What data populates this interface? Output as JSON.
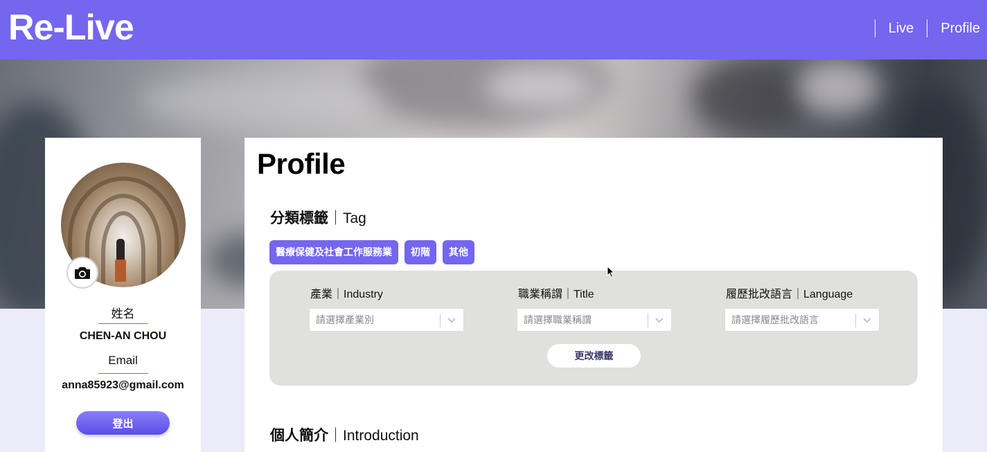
{
  "app": {
    "logo": "Re-Live"
  },
  "nav": {
    "items": [
      "Live",
      "Profile"
    ]
  },
  "sidebar": {
    "name_label": "姓名",
    "name_value": "CHEN-AN CHOU",
    "email_label": "Email",
    "email_value": "anna85923@gmail.com",
    "logout_label": "登出",
    "camera_icon": "camera-icon"
  },
  "main": {
    "title": "Profile",
    "tag_section": {
      "title_zh": "分類標籤",
      "title_sep": "｜",
      "title_en": "Tag"
    },
    "tags": [
      "醫療保健及社會工作服務業",
      "初階",
      "其他"
    ],
    "filters": [
      {
        "label": "產業｜Industry",
        "placeholder": "請選擇產業別"
      },
      {
        "label": "職業稱謂｜Title",
        "placeholder": "請選擇職業稱謂"
      },
      {
        "label": "履歷批改語言｜Language",
        "placeholder": "請選擇履歷批改語言"
      }
    ],
    "change_button": "更改標籤",
    "intro_section": {
      "title_zh": "個人簡介",
      "title_sep": "｜",
      "title_en": "Introduction"
    }
  },
  "colors": {
    "accent": "#7466ee",
    "panel": "#e0e0dc",
    "background": "#ecebfa"
  }
}
